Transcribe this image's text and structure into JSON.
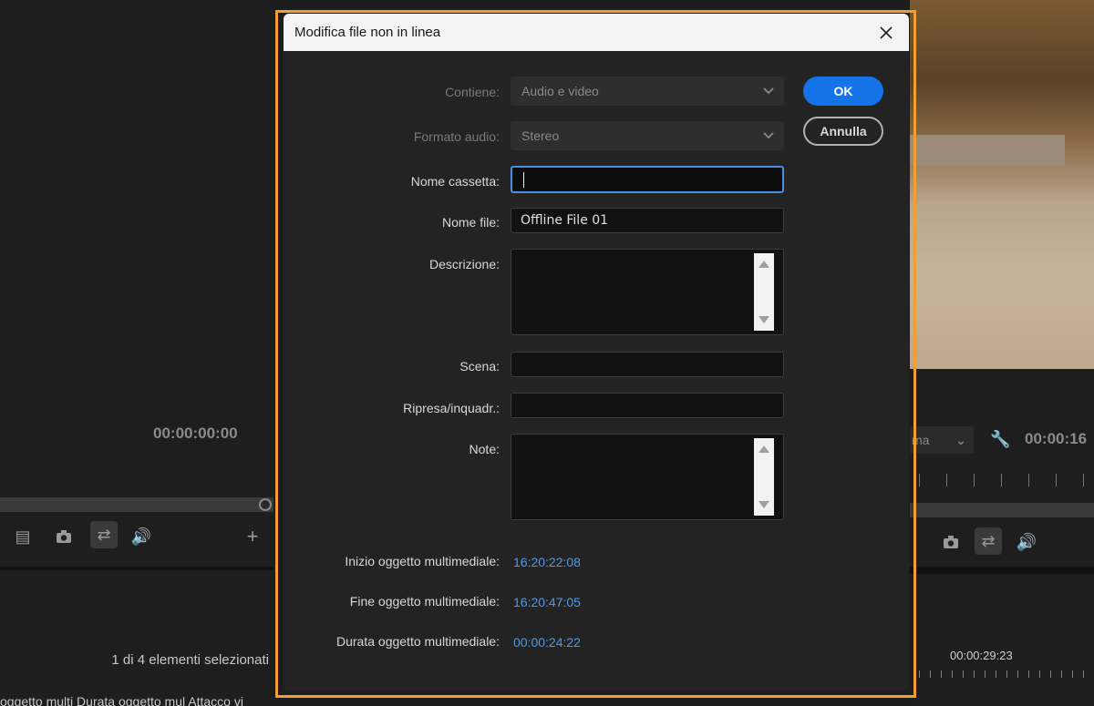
{
  "background": {
    "left_panel": {
      "timecode": "00:00:00:00",
      "selection_status": "1 di 4 elementi selezionati",
      "column_headers": "oggetto multi    Durata oggetto mul  Attacco vi"
    },
    "right_panel": {
      "timecode": "00:00:16",
      "fit_label": "ma",
      "sequence_timecode": "00:00:29:23"
    }
  },
  "dialog": {
    "title": "Modifica file non in linea",
    "close_icon": "close-icon",
    "fields": {
      "contiene_label": "Contiene:",
      "contiene_value": "Audio e video",
      "formato_label": "Formato audio:",
      "formato_value": "Stereo",
      "cassetta_label": "Nome cassetta:",
      "cassetta_value": "",
      "file_label": "Nome file:",
      "file_value": "Offline File 01",
      "descrizione_label": "Descrizione:",
      "descrizione_value": "",
      "scena_label": "Scena:",
      "scena_value": "",
      "ripresa_label": "Ripresa/inquadr.:",
      "ripresa_value": "",
      "note_label": "Note:",
      "note_value": ""
    },
    "media": {
      "inizio_label": "Inizio oggetto multimediale:",
      "inizio_value": "16:20:22:08",
      "fine_label": "Fine oggetto multimediale:",
      "fine_value": "16:20:47:05",
      "durata_label": "Durata oggetto multimediale:",
      "durata_value": "00:00:24:22"
    },
    "buttons": {
      "ok": "OK",
      "cancel": "Annulla"
    },
    "colors": {
      "accent": "#1473e6",
      "timecode_value": "#4a9cf0",
      "highlight_border": "#f0a030"
    }
  }
}
